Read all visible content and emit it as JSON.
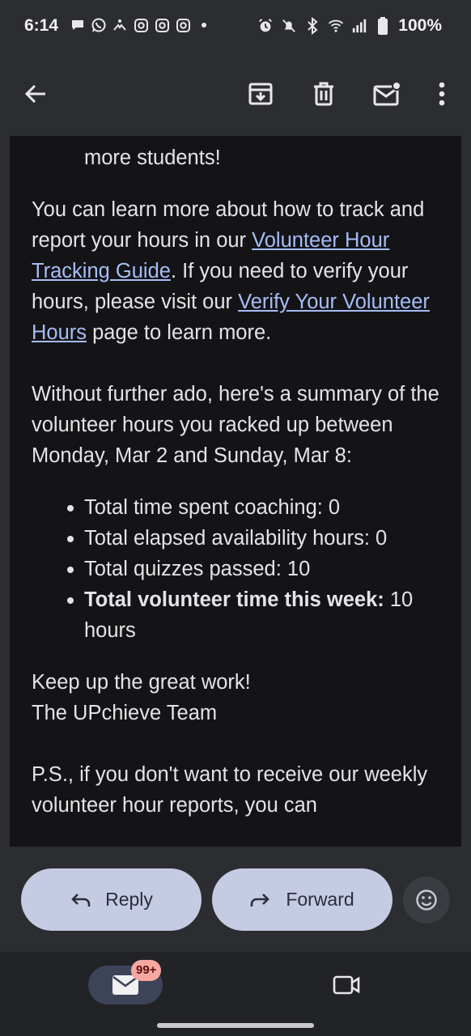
{
  "status_bar": {
    "time": "6:14",
    "battery": "100%",
    "left_icons": [
      "chat-bubble-icon",
      "whatsapp-icon",
      "dogpaw-icon",
      "instagram-icon",
      "instagram-icon",
      "instagram-icon",
      "dot-icon"
    ],
    "right_icons": [
      "alarm-icon",
      "bell-off-icon",
      "bluetooth-icon",
      "wifi-icon",
      "signal-icon",
      "battery-icon"
    ]
  },
  "app_bar": {
    "icons": [
      "back-arrow-icon",
      "archive-icon",
      "trash-icon",
      "mark-unread-icon",
      "more-vert-icon"
    ]
  },
  "email": {
    "partial_top_line": "more students!",
    "para1_text_a": "You can learn more about how to track and report your hours in our ",
    "para1_link1": "Volunteer Hour Tracking Guide",
    "para1_text_b": ". If you need to verify your hours, please visit our ",
    "para1_link2": "Verify Your Volunteer Hours",
    "para1_text_c": " page to learn more.",
    "para2": "Without further ado, here's a summary of the volunteer hours you racked up between Monday, Mar 2 and Sunday, Mar 8:",
    "bullets": {
      "coaching": "Total time spent coaching: 0",
      "availability": "Total elapsed availability hours: 0",
      "quizzes": "Total quizzes passed: 10",
      "total_label": "Total volunteer time this week:",
      "total_value": " 10 hours"
    },
    "signoff_line1": "Keep up the great work!",
    "signoff_line2": "The UPchieve Team",
    "ps": "P.S., if you don't want to receive our weekly volunteer hour reports, you can"
  },
  "actions": {
    "reply_label": "Reply",
    "forward_label": "Forward"
  },
  "nav": {
    "mail_badge": "99+"
  },
  "colors": {
    "link": "#a6bdf7",
    "pill_bg": "#c5cbe2",
    "body_bg": "#141417",
    "chrome_bg": "#2b2d31"
  }
}
